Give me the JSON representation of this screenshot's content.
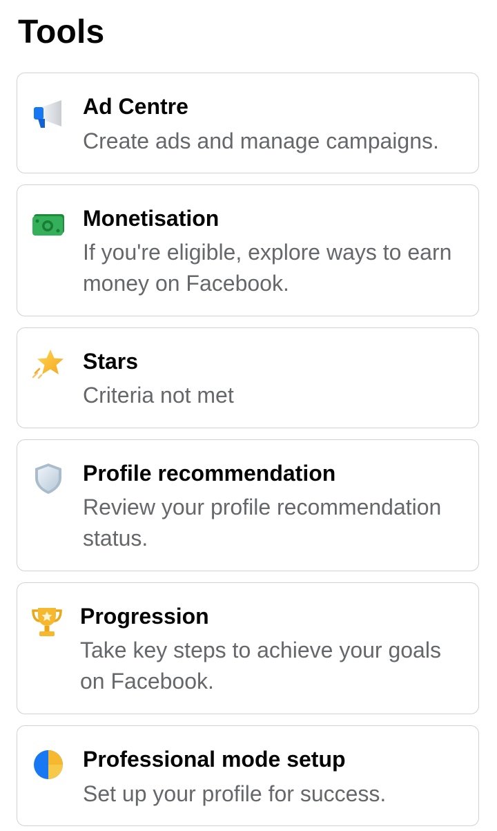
{
  "header": {
    "title": "Tools"
  },
  "tools": [
    {
      "title": "Ad Centre",
      "description": "Create ads and manage campaigns.",
      "icon": "megaphone-icon"
    },
    {
      "title": "Monetisation",
      "description": "If you're eligible, explore ways to earn money on Facebook.",
      "icon": "money-icon"
    },
    {
      "title": "Stars",
      "description": "Criteria not met",
      "icon": "star-icon"
    },
    {
      "title": "Profile recommendation",
      "description": "Review your profile recommendation status.",
      "icon": "shield-icon"
    },
    {
      "title": "Progression",
      "description": "Take key steps to achieve your goals on Facebook.",
      "icon": "trophy-icon"
    },
    {
      "title": "Professional mode setup",
      "description": "Set up your profile for success.",
      "icon": "pie-chart-icon"
    }
  ]
}
